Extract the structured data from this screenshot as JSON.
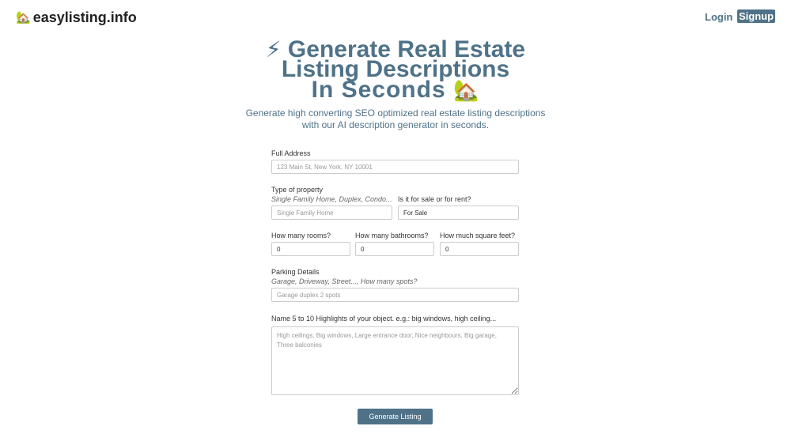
{
  "header": {
    "logo_icon": "🏡",
    "logo_text": "easylisting.info",
    "login_label": "Login",
    "signup_label": "Signup"
  },
  "hero": {
    "bolt_icon": "⚡",
    "title_line1": "Generate Real Estate",
    "title_line2": "Listing Descriptions",
    "title_line3": "In Seconds",
    "house_icon": "🏡",
    "tagline": "Generate high converting SEO optimized real estate listing descriptions with our AI description generator in seconds."
  },
  "form": {
    "address": {
      "label": "Full Address",
      "placeholder": "123 Main St, New York, NY 10001"
    },
    "property_type": {
      "label": "Type of property",
      "hint": "Single Family Home, Duplex, Condo...",
      "placeholder": "Single Family Home"
    },
    "sale_rent": {
      "label": "Is it for sale or for rent?",
      "value": "For Sale"
    },
    "rooms": {
      "label": "How many rooms?",
      "value": "0"
    },
    "bathrooms": {
      "label": "How many bathrooms?",
      "value": "0"
    },
    "sqft": {
      "label": "How much square feet?",
      "value": "0"
    },
    "parking": {
      "label": "Parking Details",
      "hint": "Garage, Driveway, Street..., How many spots?",
      "placeholder": "Garage duplex 2 spots"
    },
    "highlights": {
      "label": "Name 5 to 10 Highlights of your object. e.g.: big windows, high ceiling...",
      "placeholder": "High ceilings, Big windows, Large entrance door, Nice neighbours, Big garage, Three balconies"
    },
    "submit_label": "Generate Listing"
  },
  "colors": {
    "accent": "#4f7288",
    "background": "#ffffff"
  }
}
